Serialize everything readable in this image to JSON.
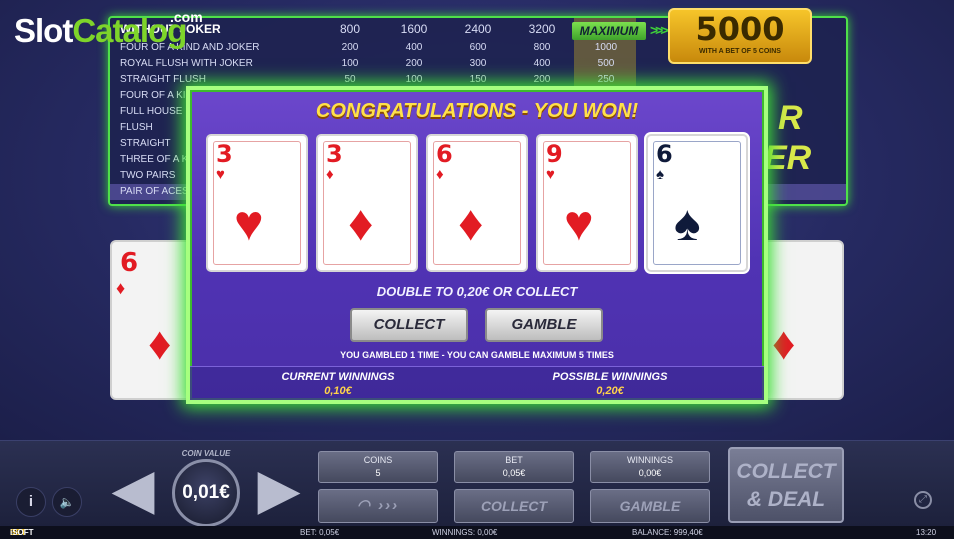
{
  "site_logo": {
    "slot": "Slot",
    "catalog": "Catalog",
    "com": ".com"
  },
  "paytable": {
    "header": {
      "hand": "WITHOUT JOKER",
      "pays": [
        "800",
        "1600",
        "2400",
        "3200"
      ],
      "max_label": "MAXIMUM"
    },
    "rows": [
      {
        "hand": "FOUR OF A KIND AND JOKER",
        "pays": [
          "200",
          "400",
          "600",
          "800",
          "1000"
        ]
      },
      {
        "hand": "ROYAL FLUSH WITH JOKER",
        "pays": [
          "100",
          "200",
          "300",
          "400",
          "500"
        ]
      },
      {
        "hand": "STRAIGHT FLUSH",
        "pays": [
          "50",
          "100",
          "150",
          "200",
          "250"
        ]
      },
      {
        "hand": "FOUR OF A KI",
        "pays": [
          "",
          "",
          "",
          "",
          ""
        ]
      },
      {
        "hand": "FULL HOUSE",
        "pays": [
          "",
          "",
          "",
          "",
          ""
        ]
      },
      {
        "hand": "FLUSH",
        "pays": [
          "",
          "",
          "",
          "",
          ""
        ]
      },
      {
        "hand": "STRAIGHT",
        "pays": [
          "",
          "",
          "",
          "",
          ""
        ]
      },
      {
        "hand": "THREE OF A KI",
        "pays": [
          "",
          "",
          "",
          "",
          ""
        ]
      },
      {
        "hand": "TWO PAIRS",
        "pays": [
          "",
          "",
          "",
          "",
          ""
        ]
      },
      {
        "hand": "PAIR OF ACES",
        "pays": [
          "",
          "",
          "",
          "",
          ""
        ]
      }
    ]
  },
  "jackpot": {
    "amount": "5000",
    "subtitle": "WITH A BET OF 5 COINS"
  },
  "logo_partial": {
    "line1": "R",
    "line2": "ER"
  },
  "background_cards": [
    {
      "rank": "6",
      "suit": "♦"
    },
    {
      "rank": "",
      "suit": "♦"
    }
  ],
  "modal": {
    "title": "CONGRATULATIONS - YOU WON!",
    "cards": [
      {
        "rank": "3",
        "suit": "♥",
        "color": "red"
      },
      {
        "rank": "3",
        "suit": "♦",
        "color": "red"
      },
      {
        "rank": "6",
        "suit": "♦",
        "color": "red"
      },
      {
        "rank": "9",
        "suit": "♥",
        "color": "red"
      },
      {
        "rank": "6",
        "suit": "♠",
        "color": "black"
      }
    ],
    "double_text": "DOUBLE TO 0,20€ OR COLLECT",
    "collect_label": "COLLECT",
    "gamble_label": "GAMBLE",
    "gambled_text": "YOU GAMBLED 1 TIME - YOU CAN GAMBLE MAXIMUM 5 TIMES",
    "current_winnings_label": "CURRENT WINNINGS",
    "current_winnings_value": "0,10€",
    "possible_winnings_label": "POSSIBLE WINNINGS",
    "possible_winnings_value": "0,20€"
  },
  "controls": {
    "info_icon": "i",
    "sound_icon": "🔈",
    "minus": "−",
    "plus": "+",
    "coin_value_label": "COIN VALUE",
    "coin_value": "0,01€",
    "coins_label": "COINS",
    "coins_value": "5",
    "bet_label": "BET",
    "bet_value": "0,05€",
    "winnings_label": "WINNINGS",
    "winnings_value": "0,00€",
    "auto_label": "◠ ›››",
    "collect_label": "COLLECT",
    "gamble_label": "GAMBLE",
    "deal_line1": "COLLECT",
    "deal_line2": "& DEAL",
    "expand_icon": "⤢"
  },
  "status": {
    "brand_i": "iSOFT",
    "brand_b": "BET",
    "bet": "BET: 0,05€",
    "winnings": "WINNINGS: 0,00€",
    "balance": "BALANCE: 999,40€",
    "time": "13:20"
  }
}
